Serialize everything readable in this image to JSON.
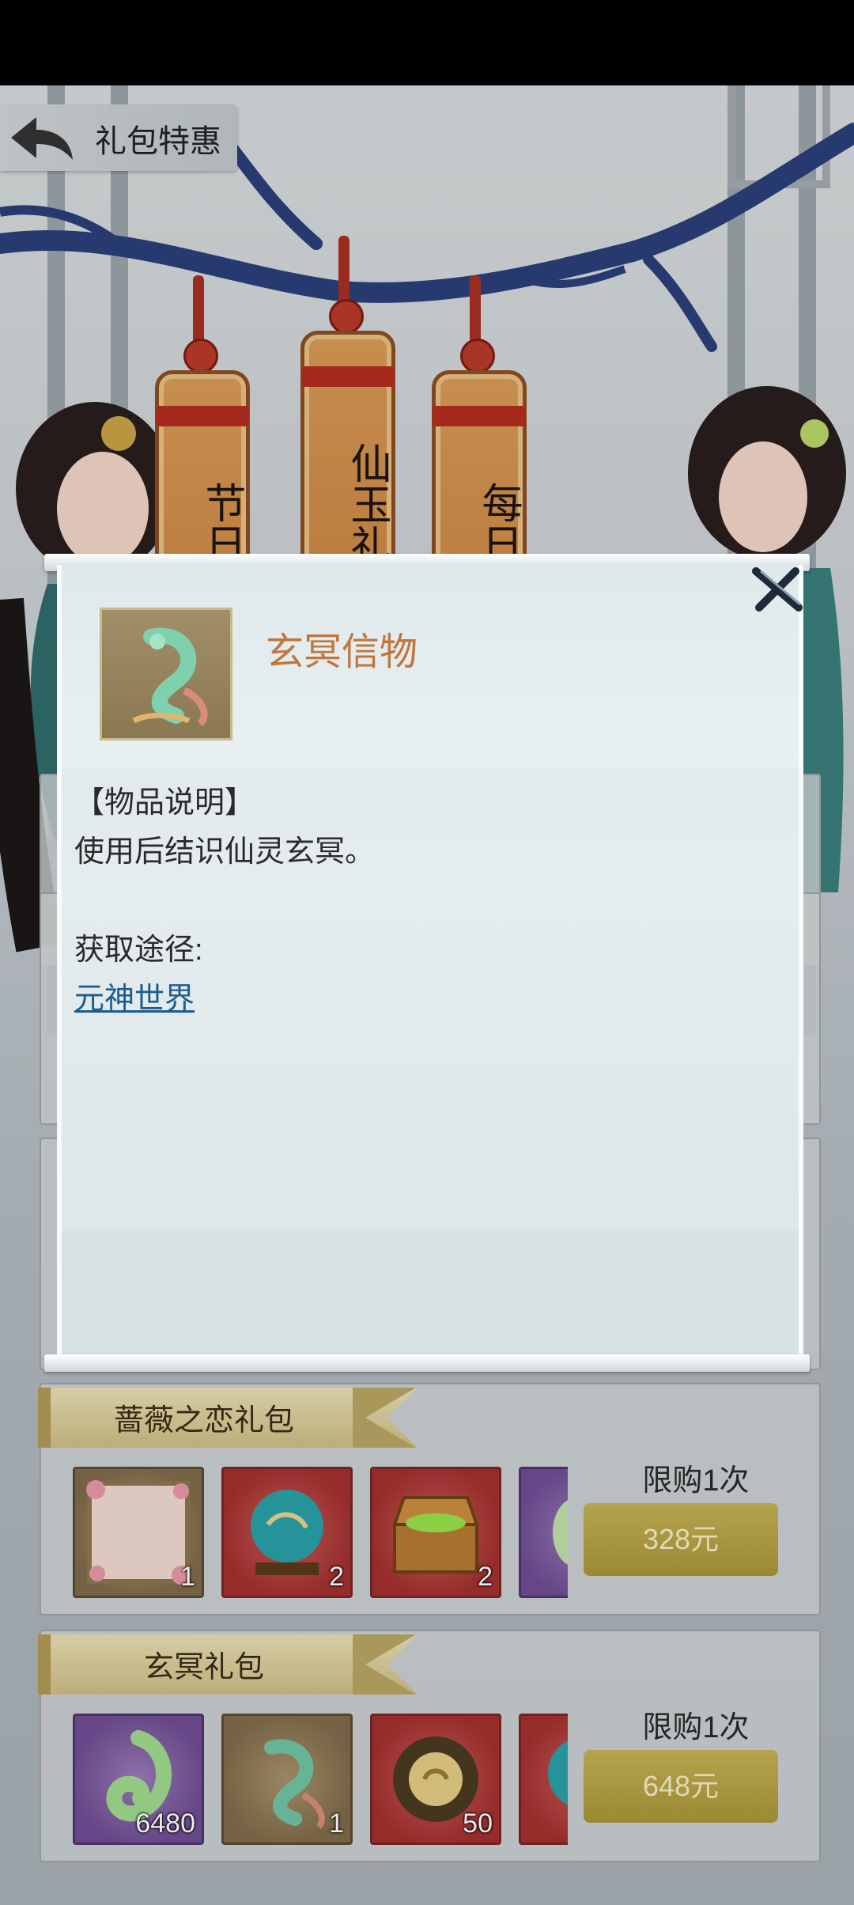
{
  "header": {
    "title": "礼包特惠"
  },
  "tags": [
    {
      "label": "节日特惠"
    },
    {
      "label": "仙玉礼包"
    },
    {
      "label": "每日特惠"
    }
  ],
  "dialog": {
    "item_name": "玄冥信物",
    "section_heading": "【物品说明】",
    "description": "使用后结识仙灵玄冥。",
    "source_label": "获取途径:",
    "source_link": "元神世界"
  },
  "packages": [
    {
      "title": "蔷薇之恋礼包",
      "limit": "限购1次",
      "price": "328元",
      "items": [
        {
          "icon": "rose-frame-icon",
          "count": "1",
          "style": "brown"
        },
        {
          "icon": "spirit-orb-icon",
          "count": "2",
          "style": "red"
        },
        {
          "icon": "treasure-chest-icon",
          "count": "2",
          "style": "red"
        },
        {
          "icon": "jade-icon",
          "count": "",
          "style": "purple"
        }
      ]
    },
    {
      "title": "玄冥礼包",
      "limit": "限购1次",
      "price": "648元",
      "items": [
        {
          "icon": "jade-fish-icon",
          "count": "6480",
          "style": "purple"
        },
        {
          "icon": "jade-dragon-icon",
          "count": "1",
          "style": "brown"
        },
        {
          "icon": "bronze-coin-icon",
          "count": "50",
          "style": "red"
        },
        {
          "icon": "spirit-orb-icon",
          "count": "",
          "style": "red"
        }
      ]
    }
  ],
  "colors": {
    "item_name": "#c0763c",
    "link": "#1a5d8e",
    "buy_button": "#b8a546"
  }
}
